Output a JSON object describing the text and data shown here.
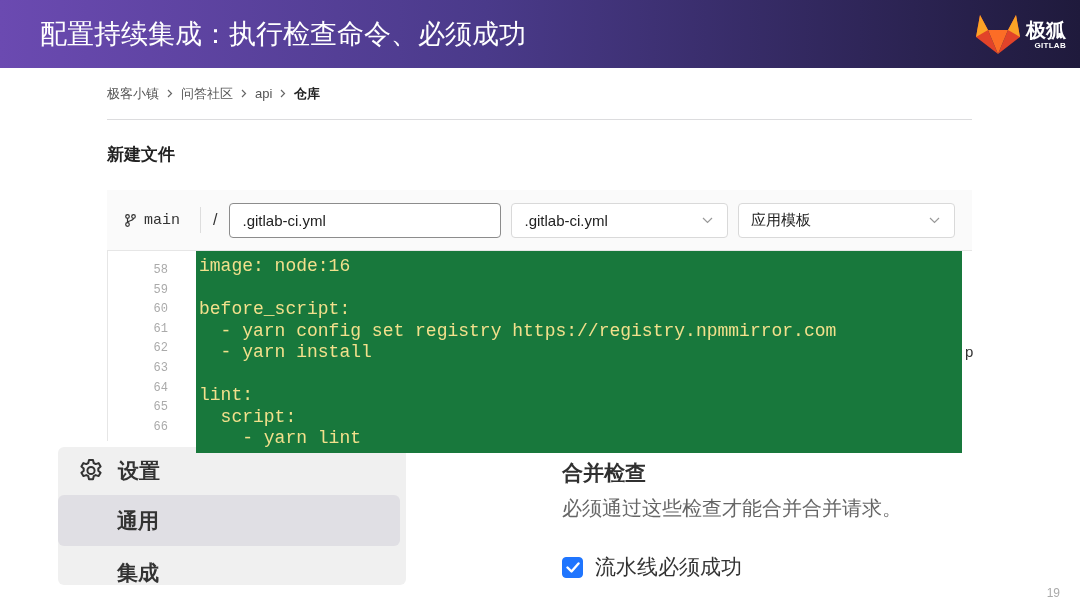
{
  "header": {
    "title": "配置持续集成：执行检查命令、必须成功",
    "logo": {
      "name": "极狐",
      "sub": "GITLAB"
    }
  },
  "breadcrumb": [
    {
      "label": "极客小镇",
      "current": false
    },
    {
      "label": "问答社区",
      "current": false
    },
    {
      "label": "api",
      "current": false
    },
    {
      "label": "仓库",
      "current": true
    }
  ],
  "page_title": "新建文件",
  "editor": {
    "branch": "main",
    "separator": "/",
    "file_name": {
      "value": ".gitlab-ci.yml"
    },
    "template_type": {
      "value": ".gitlab-ci.yml"
    },
    "template": {
      "value": "应用模板"
    },
    "line_numbers": [
      "58",
      "59",
      "60",
      "61",
      "62",
      "63",
      "64",
      "65",
      "66"
    ],
    "hidden_text": "p"
  },
  "code_overlay": {
    "blocks": [
      [
        "image: node:16"
      ],
      [
        "before_script:",
        "  - yarn config set registry https://registry.npmmirror.com",
        "  - yarn install"
      ],
      [
        "lint:",
        "  script:",
        "    - yarn lint"
      ]
    ]
  },
  "settings_menu": {
    "title": "设置",
    "items": [
      {
        "label": "通用",
        "selected": true
      },
      {
        "label": "集成",
        "selected": false
      }
    ]
  },
  "merge_checks": {
    "title": "合并检查",
    "description": "必须通过这些检查才能合并合并请求。",
    "options": [
      {
        "label": "流水线必须成功",
        "checked": true
      }
    ]
  },
  "page_number": "19"
}
